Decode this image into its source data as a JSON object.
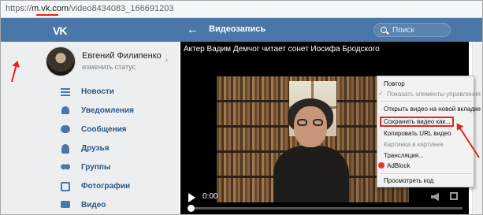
{
  "browser": {
    "url_prefix": "https://",
    "url_host": "m.vk.com",
    "url_path": "/video8434083_166691203"
  },
  "header": {
    "logo": "VK",
    "back_icon": "arrow-left-icon",
    "title": "Видеозапись",
    "search_placeholder": "Поиск"
  },
  "profile": {
    "name": "Евгений Филипенко",
    "status": "изменить статус"
  },
  "sidebar": {
    "items": [
      {
        "label": "Новости",
        "icon": "news-icon"
      },
      {
        "label": "Уведомления",
        "icon": "bell-icon"
      },
      {
        "label": "Сообщения",
        "icon": "message-icon"
      },
      {
        "label": "Друзья",
        "icon": "friends-icon"
      },
      {
        "label": "Группы",
        "icon": "groups-icon"
      },
      {
        "label": "Фотографии",
        "icon": "photos-icon"
      },
      {
        "label": "Видео",
        "icon": "video-icon"
      }
    ]
  },
  "video": {
    "title": "Актер Вадим Демчог читает сонет Иосифа Бродского",
    "time": "0:00",
    "progress": 0
  },
  "context_menu": {
    "items": [
      {
        "label": "Повтор",
        "disabled": false
      },
      {
        "label": "Показать элементы управления",
        "disabled": true,
        "checked": true
      },
      {
        "label": "Открыть видео на новой вкладке",
        "disabled": false
      },
      {
        "label": "Сохранить видео как...",
        "disabled": false,
        "highlighted": true
      },
      {
        "label": "Копировать URL видео",
        "disabled": false
      },
      {
        "label": "Картинка в картинке",
        "disabled": true
      },
      {
        "label": "Трансляция...",
        "disabled": false
      },
      {
        "label": "AdBlock",
        "disabled": false
      },
      {
        "label": "Просмотреть код",
        "disabled": false
      }
    ]
  },
  "colors": {
    "vk_blue": "#4a76a8",
    "annotation_red": "#e0261d",
    "sidebar_bg": "#edeef0"
  }
}
